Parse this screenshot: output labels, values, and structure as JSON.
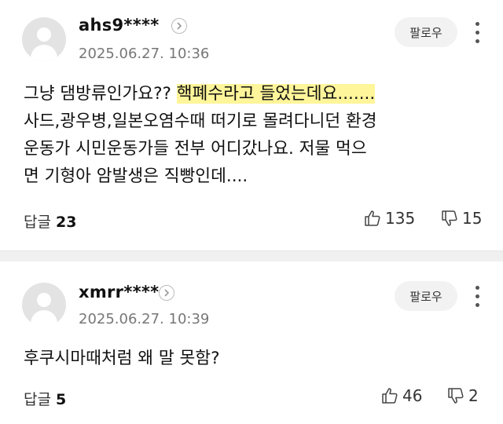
{
  "comments": [
    {
      "username": "ahs9****",
      "date": "2025.06.27. 10:36",
      "follow_label": "팔로우",
      "text": {
        "line1_before": "그냥 댐방류인가요?? ",
        "line1_highlight": "핵폐수라고 들었는데요.......",
        "line2": "사드,광우병,일본오염수때 떠기로 몰려다니던 환경",
        "line3": "운동가 시민운동가들 전부 어디갔나요. 저물 먹으",
        "line4": "면 기형아 암발생은 직빵인데...."
      },
      "reply_label": "답글",
      "reply_count": "23",
      "likes": "135",
      "dislikes": "15"
    },
    {
      "username": "xmrr****",
      "date": "2025.06.27. 10:39",
      "follow_label": "팔로우",
      "text": {
        "line1": "후쿠시마때처럼 왜 말 못함?"
      },
      "reply_label": "답글",
      "reply_count": "5",
      "likes": "46",
      "dislikes": "2"
    }
  ],
  "colors": {
    "highlight": "#fff59a",
    "avatar_bg": "#e3e3e3",
    "follow_bg": "#f2f2f2",
    "divider": "#f0f0f0"
  },
  "icons": [
    "chevron-right-icon",
    "more-vertical-icon",
    "thumbs-up-icon",
    "thumbs-down-icon",
    "avatar-placeholder-icon"
  ]
}
